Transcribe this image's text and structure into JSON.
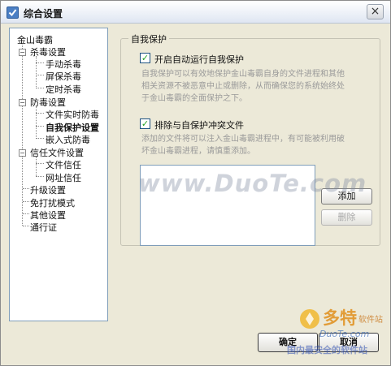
{
  "window": {
    "title": "综合设置",
    "app_icon": "check-icon",
    "close_glyph": "×"
  },
  "tree": {
    "root": "金山毒霸",
    "groups": [
      {
        "label": "杀毒设置",
        "children": [
          "手动杀毒",
          "屏保杀毒",
          "定时杀毒"
        ]
      },
      {
        "label": "防毒设置",
        "children": [
          "文件实时防毒",
          "自我保护设置",
          "嵌入式防毒"
        ]
      },
      {
        "label": "信任文件设置",
        "children": [
          "文件信任",
          "网址信任"
        ]
      }
    ],
    "leaves": [
      "升级设置",
      "免打扰模式",
      "其他设置",
      "通行证"
    ],
    "selected": "自我保护设置"
  },
  "section": {
    "legend": "自我保护",
    "option1": {
      "label": "开启自动运行自我保护",
      "checked": true,
      "desc1": "自我保护可以有效地保护金山毒霸自身的文件进程和其他",
      "desc2": "相关资源不被恶意中止或删除，从而确保您的系统始终处",
      "desc3": "于金山毒霸的全面保护之下。"
    },
    "option2": {
      "label": "排除与自保护冲突文件",
      "checked": true,
      "desc1": "添加的文件将可以注入金山毒霸进程中，有可能被利用破",
      "desc2": "坏金山毒霸进程，请慎重添加。"
    },
    "add_button": "添加",
    "delete_button": "删除"
  },
  "footer": {
    "ok": "确定",
    "cancel": "取消"
  },
  "watermark": {
    "main": "www.DuoTe.com",
    "logo_text": "多特",
    "logo_sub": "软件站",
    "logo_url": "DuoTe.com",
    "bottom": "国内最安全的软件站"
  }
}
